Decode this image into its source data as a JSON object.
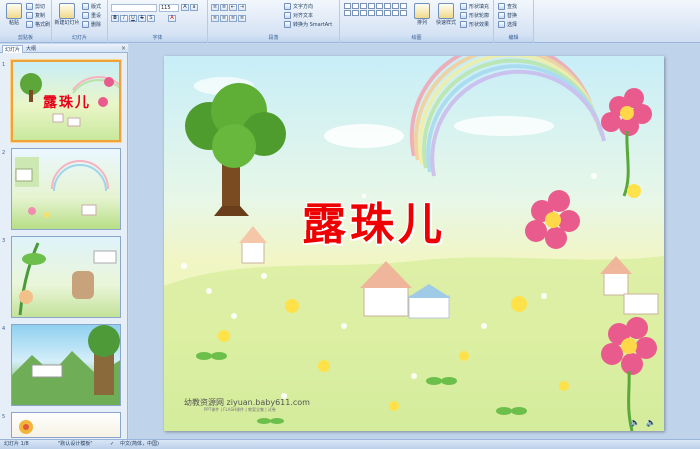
{
  "ribbon": {
    "groups": {
      "clipboard": "剪贴板",
      "slides": "幻灯片",
      "font": "字体",
      "paragraph": "段落",
      "drawing": "绘图",
      "editing": "编辑"
    },
    "paste": "粘贴",
    "cut": "剪切",
    "copy": "复制",
    "format_painter": "格式刷",
    "new_slide": "新建幻灯片",
    "layout": "版式",
    "reset": "重设",
    "delete": "删除",
    "font_size": "115",
    "text_direction": "文字方向",
    "align_text": "对齐文本",
    "smartart": "转换为 SmartArt",
    "arrange": "排列",
    "quick_styles": "快速样式",
    "shape_fill": "形状填充",
    "shape_outline": "形状轮廓",
    "shape_effects": "形状效果",
    "find": "查找",
    "replace": "替换",
    "select": "选择"
  },
  "panel": {
    "tabs": [
      "幻灯片",
      "大纲"
    ],
    "close_glyph": "×",
    "slides": [
      {
        "num": "1",
        "title": "露珠儿"
      },
      {
        "num": "2"
      },
      {
        "num": "3"
      },
      {
        "num": "4"
      },
      {
        "num": "5"
      }
    ]
  },
  "slide": {
    "title": "露珠儿",
    "watermark": "幼教资源网 ziyuan.baby611.com",
    "watermark_sub": "PPT课件 | FLASH课件 | 教案全集 | 试卷",
    "speaker_glyph": "🔈"
  },
  "status": {
    "slide_counter": "幻灯片 1/8",
    "theme": "\"默认设计模板\"",
    "language": "中文(简体，中国)"
  },
  "colors": {
    "title_red": "#ee0000",
    "ribbon_text": "#15428b",
    "selection_orange": "#f0a23a"
  }
}
